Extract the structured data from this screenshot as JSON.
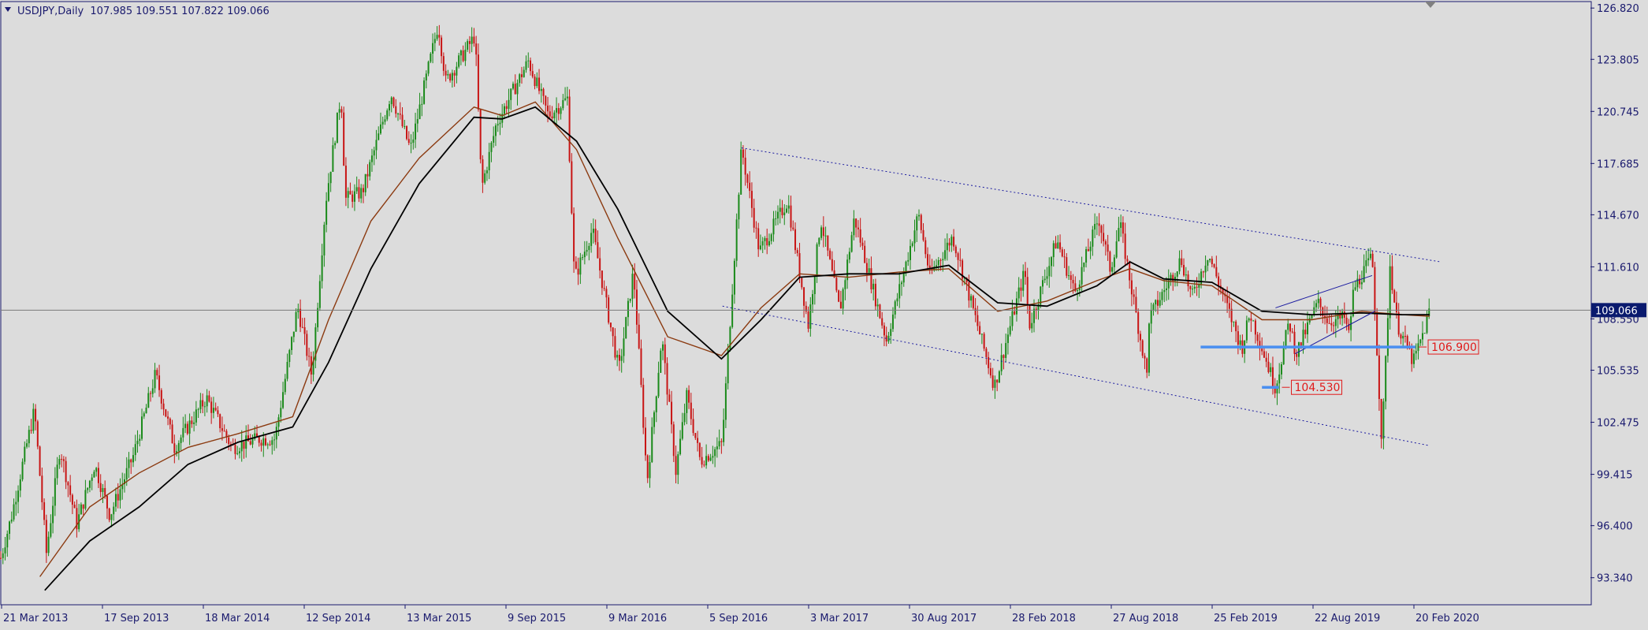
{
  "header": {
    "symbol_line": "USDJPY,Daily  107.985 109.551 107.822 109.066"
  },
  "colors": {
    "background": "#dcdcdc",
    "axis_text": "#1a1a6e",
    "bull": "#1a8a1a",
    "bear": "#c81414",
    "ma_fast": "#8b3a10",
    "ma_slow": "#000000",
    "trend_lines": "#1a1aa0",
    "support": "#4a8ff0",
    "label_red": "#e01a1a",
    "current_price_box": "#0a1a6e"
  },
  "chart_data": {
    "type": "candlestick",
    "title": "USDJPY,Daily",
    "ohlc_last": {
      "open": 107.985,
      "high": 109.551,
      "low": 107.822,
      "close": 109.066
    },
    "x_tick_labels": [
      "21 Mar 2013",
      "17 Sep 2013",
      "18 Mar 2014",
      "12 Sep 2014",
      "13 Mar 2015",
      "9 Sep 2015",
      "9 Mar 2016",
      "5 Sep 2016",
      "3 Mar 2017",
      "30 Aug 2017",
      "28 Feb 2018",
      "27 Aug 2018",
      "25 Feb 2019",
      "22 Aug 2019",
      "20 Feb 2020"
    ],
    "y_tick_labels": [
      "126.820",
      "123.805",
      "120.745",
      "117.685",
      "114.670",
      "111.610",
      "108.550",
      "105.535",
      "102.475",
      "99.415",
      "96.400",
      "93.340"
    ],
    "ylim": [
      91.75,
      127.2
    ],
    "current_price": 109.066,
    "current_price_label": "109.066",
    "price_path": [
      [
        "2013-03-21",
        94.5
      ],
      [
        "2013-04-10",
        97.0
      ],
      [
        "2013-05-10",
        101.5
      ],
      [
        "2013-05-22",
        103.2
      ],
      [
        "2013-06-13",
        94.8
      ],
      [
        "2013-07-08",
        101.0
      ],
      [
        "2013-08-08",
        96.5
      ],
      [
        "2013-09-10",
        100.0
      ],
      [
        "2013-10-08",
        97.0
      ],
      [
        "2013-11-20",
        100.5
      ],
      [
        "2013-12-31",
        105.3
      ],
      [
        "2014-02-04",
        101.0
      ],
      [
        "2014-04-04",
        103.9
      ],
      [
        "2014-05-21",
        101.0
      ],
      [
        "2014-07-10",
        101.5
      ],
      [
        "2014-08-08",
        101.5
      ],
      [
        "2014-09-19",
        109.3
      ],
      [
        "2014-10-15",
        105.2
      ],
      [
        "2014-11-10",
        115.5
      ],
      [
        "2014-12-08",
        121.8
      ],
      [
        "2014-12-16",
        115.6
      ],
      [
        "2015-01-16",
        116.0
      ],
      [
        "2015-03-10",
        121.8
      ],
      [
        "2015-04-15",
        118.5
      ],
      [
        "2015-06-05",
        125.9
      ],
      [
        "2015-06-19",
        122.5
      ],
      [
        "2015-08-12",
        125.2
      ],
      [
        "2015-08-24",
        116.2
      ],
      [
        "2015-09-20",
        120.0
      ],
      [
        "2015-11-18",
        123.7
      ],
      [
        "2015-12-25",
        120.5
      ],
      [
        "2016-01-29",
        121.5
      ],
      [
        "2016-02-11",
        110.9
      ],
      [
        "2016-03-15",
        113.8
      ],
      [
        "2016-05-03",
        105.5
      ],
      [
        "2016-05-30",
        111.4
      ],
      [
        "2016-06-24",
        99.0
      ],
      [
        "2016-07-21",
        107.5
      ],
      [
        "2016-08-16",
        99.6
      ],
      [
        "2016-09-05",
        104.0
      ],
      [
        "2016-09-30",
        100.2
      ],
      [
        "2016-11-09",
        101.2
      ],
      [
        "2016-12-15",
        118.6
      ],
      [
        "2017-01-17",
        112.5
      ],
      [
        "2017-03-10",
        115.5
      ],
      [
        "2017-04-17",
        108.2
      ],
      [
        "2017-05-10",
        114.4
      ],
      [
        "2017-06-14",
        109.0
      ],
      [
        "2017-07-11",
        114.5
      ],
      [
        "2017-09-08",
        107.3
      ],
      [
        "2017-11-06",
        114.7
      ],
      [
        "2017-11-27",
        111.1
      ],
      [
        "2018-01-08",
        113.4
      ],
      [
        "2018-03-26",
        104.6
      ],
      [
        "2018-05-21",
        111.4
      ],
      [
        "2018-05-29",
        108.1
      ],
      [
        "2018-07-19",
        113.2
      ],
      [
        "2018-08-21",
        110.1
      ],
      [
        "2018-10-04",
        114.5
      ],
      [
        "2018-10-26",
        111.4
      ],
      [
        "2018-11-12",
        114.2
      ],
      [
        "2019-01-03",
        104.9
      ],
      [
        "2019-01-04",
        108.5
      ],
      [
        "2019-03-05",
        112.1
      ],
      [
        "2019-03-25",
        109.8
      ],
      [
        "2019-04-24",
        112.4
      ],
      [
        "2019-06-25",
        106.8
      ],
      [
        "2019-07-10",
        108.9
      ],
      [
        "2019-08-26",
        104.5
      ],
      [
        "2019-09-20",
        108.4
      ],
      [
        "2019-10-03",
        106.5
      ],
      [
        "2019-11-12",
        109.5
      ],
      [
        "2019-12-02",
        108.4
      ],
      [
        "2019-12-31",
        108.6
      ],
      [
        "2020-01-08",
        107.6
      ],
      [
        "2020-01-17",
        110.3
      ],
      [
        "2020-02-20",
        112.2
      ],
      [
        "2020-03-09",
        101.2
      ],
      [
        "2020-03-24",
        111.7
      ],
      [
        "2020-04-06",
        108.3
      ],
      [
        "2020-04-24",
        106.9
      ],
      [
        "2020-05-06",
        106.0
      ],
      [
        "2020-05-26",
        107.9
      ],
      [
        "2020-06-05",
        109.07
      ]
    ],
    "moving_averages": [
      {
        "role": "fast",
        "points": [
          [
            "2013-06-01",
            93.4
          ],
          [
            "2013-09-01",
            97.5
          ],
          [
            "2013-12-01",
            99.5
          ],
          [
            "2014-03-01",
            101.0
          ],
          [
            "2014-06-01",
            101.8
          ],
          [
            "2014-09-10",
            102.8
          ],
          [
            "2014-11-15",
            108.5
          ],
          [
            "2015-02-01",
            114.3
          ],
          [
            "2015-05-01",
            118.0
          ],
          [
            "2015-08-10",
            121.0
          ],
          [
            "2015-10-01",
            120.5
          ],
          [
            "2015-12-01",
            121.3
          ],
          [
            "2016-02-15",
            118.5
          ],
          [
            "2016-05-01",
            113.3
          ],
          [
            "2016-08-01",
            107.5
          ],
          [
            "2016-11-08",
            106.4
          ],
          [
            "2017-01-20",
            109.2
          ],
          [
            "2017-04-01",
            111.2
          ],
          [
            "2017-07-01",
            111.0
          ],
          [
            "2017-10-01",
            111.3
          ],
          [
            "2018-01-01",
            111.5
          ],
          [
            "2018-04-01",
            109.0
          ],
          [
            "2018-07-01",
            109.6
          ],
          [
            "2018-10-01",
            110.8
          ],
          [
            "2018-12-01",
            111.5
          ],
          [
            "2019-02-01",
            110.8
          ],
          [
            "2019-05-01",
            110.5
          ],
          [
            "2019-08-01",
            108.5
          ],
          [
            "2019-11-01",
            108.5
          ],
          [
            "2020-02-01",
            109.0
          ],
          [
            "2020-04-15",
            108.8
          ],
          [
            "2020-06-05",
            108.7
          ]
        ]
      },
      {
        "role": "slow",
        "points": [
          [
            "2013-06-10",
            92.6
          ],
          [
            "2013-09-01",
            95.5
          ],
          [
            "2013-12-01",
            97.5
          ],
          [
            "2014-03-01",
            100.0
          ],
          [
            "2014-06-01",
            101.3
          ],
          [
            "2014-09-10",
            102.2
          ],
          [
            "2014-11-15",
            106.0
          ],
          [
            "2015-02-01",
            111.5
          ],
          [
            "2015-05-01",
            116.5
          ],
          [
            "2015-08-10",
            120.4
          ],
          [
            "2015-10-01",
            120.3
          ],
          [
            "2015-12-01",
            121.0
          ],
          [
            "2016-02-15",
            119.0
          ],
          [
            "2016-05-01",
            115.0
          ],
          [
            "2016-08-01",
            109.0
          ],
          [
            "2016-11-08",
            106.2
          ],
          [
            "2017-01-20",
            108.5
          ],
          [
            "2017-04-01",
            111.0
          ],
          [
            "2017-07-01",
            111.2
          ],
          [
            "2017-10-01",
            111.2
          ],
          [
            "2018-01-01",
            111.7
          ],
          [
            "2018-04-01",
            109.5
          ],
          [
            "2018-07-01",
            109.3
          ],
          [
            "2018-10-01",
            110.5
          ],
          [
            "2018-12-01",
            111.9
          ],
          [
            "2019-02-01",
            110.9
          ],
          [
            "2019-05-01",
            110.7
          ],
          [
            "2019-08-01",
            109.0
          ],
          [
            "2019-11-01",
            108.8
          ],
          [
            "2020-02-01",
            108.9
          ],
          [
            "2020-04-15",
            108.8
          ],
          [
            "2020-06-05",
            108.8
          ]
        ]
      }
    ],
    "trendlines": [
      {
        "style": "dotted",
        "from": [
          "2016-12-15",
          118.6
        ],
        "to": [
          "2020-06-26",
          111.9
        ]
      },
      {
        "style": "dotted",
        "from": [
          "2016-11-10",
          109.3
        ],
        "to": [
          "2020-06-05",
          101.1
        ]
      },
      {
        "style": "solid",
        "from": [
          "2019-08-26",
          109.2
        ],
        "to": [
          "2020-02-20",
          111.1
        ]
      },
      {
        "style": "solid",
        "from": [
          "2019-10-01",
          106.5
        ],
        "to": [
          "2020-02-25",
          109.0
        ]
      }
    ],
    "levels": [
      {
        "price": 106.9,
        "label": "106.900",
        "from": "2019-04-10",
        "to": "2020-05-10"
      },
      {
        "price": 104.53,
        "label": "104.530",
        "from": "2019-08-01",
        "to": "2019-09-01"
      }
    ]
  }
}
